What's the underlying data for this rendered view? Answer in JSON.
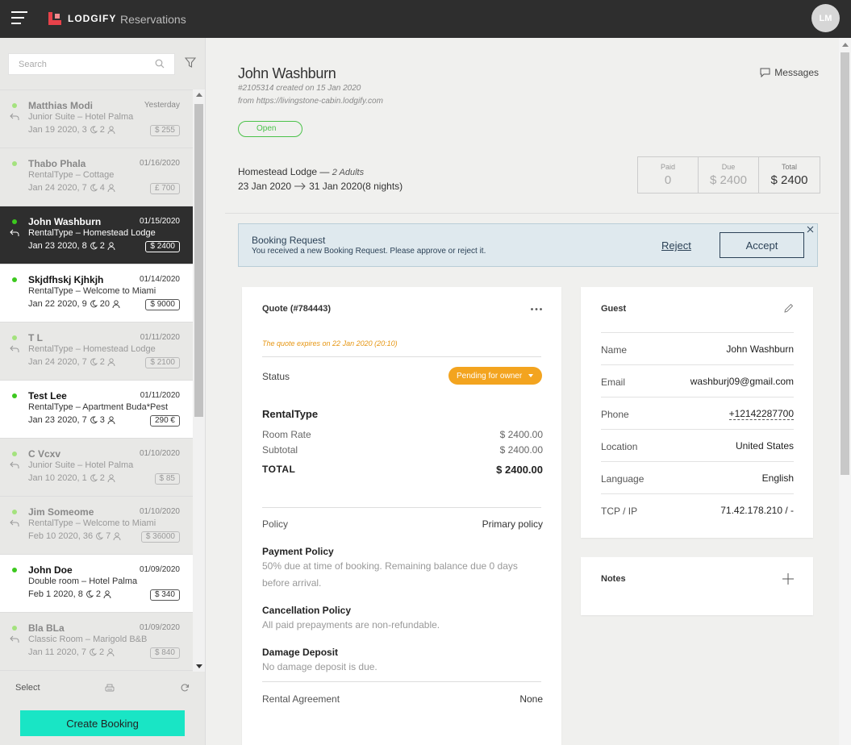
{
  "app": {
    "brand": "LODGIFY",
    "section": "Reservations",
    "user_initials": "LM"
  },
  "sidebar": {
    "search_placeholder": "Search",
    "reservations": [
      {
        "name": "Matthias Modi",
        "date": "Yesterday",
        "rental": "Junior Suite – Hotel Palma",
        "checkin": "Jan 19 2020, 3",
        "guests": "2",
        "price": "$ 255",
        "state": "read",
        "replied": true
      },
      {
        "name": "Thabo Phala",
        "date": "01/16/2020",
        "rental": "RentalType – Cottage",
        "checkin": "Jan 24 2020, 7",
        "guests": "4",
        "price": "£ 700",
        "state": "read",
        "replied": false
      },
      {
        "name": "John Washburn",
        "date": "01/15/2020",
        "rental": "RentalType – Homestead Lodge",
        "checkin": "Jan 23 2020, 8",
        "guests": "2",
        "price": "$ 2400",
        "state": "active",
        "replied": true
      },
      {
        "name": "Skjdfhskj Kjhkjh",
        "date": "01/14/2020",
        "rental": "RentalType – Welcome to Miami",
        "checkin": "Jan 22 2020, 9",
        "guests": "20",
        "price": "$ 9000",
        "state": "unread",
        "replied": false
      },
      {
        "name": "T L",
        "date": "01/11/2020",
        "rental": "RentalType – Homestead Lodge",
        "checkin": "Jan 24 2020, 7",
        "guests": "2",
        "price": "$ 2100",
        "state": "read",
        "replied": true
      },
      {
        "name": "Test Lee",
        "date": "01/11/2020",
        "rental": "RentalType – Apartment Buda*Pest",
        "checkin": "Jan 23 2020, 7",
        "guests": "3",
        "price": "290 €",
        "state": "unread",
        "replied": false
      },
      {
        "name": "C Vcxv",
        "date": "01/10/2020",
        "rental": "Junior Suite – Hotel Palma",
        "checkin": "Jan 10 2020, 1",
        "guests": "2",
        "price": "$ 85",
        "state": "read",
        "replied": true
      },
      {
        "name": "Jim Someome",
        "date": "01/10/2020",
        "rental": "RentalType – Welcome to Miami",
        "checkin": "Feb 10 2020, 36",
        "guests": "7",
        "price": "$ 36000",
        "state": "read",
        "replied": true
      },
      {
        "name": "John Doe",
        "date": "01/09/2020",
        "rental": "Double room – Hotel Palma",
        "checkin": "Feb 1 2020, 8",
        "guests": "2",
        "price": "$ 340",
        "state": "unread",
        "replied": false
      },
      {
        "name": "Bla BLa",
        "date": "01/09/2020",
        "rental": "Classic Room – Marigold B&B",
        "checkin": "Jan 11 2020, 7",
        "guests": "2",
        "price": "$ 840",
        "state": "read",
        "replied": true
      }
    ],
    "select_label": "Select",
    "create_booking": "Create  Booking"
  },
  "booking": {
    "guest_name": "John Washburn",
    "created": "#2105314 created on 15 Jan 2020",
    "from": "from https://livingstone-cabin.lodgify.com",
    "status": "Open",
    "messages_label": "Messages",
    "property": "Homestead Lodge",
    "property_sep": " — ",
    "adults": "2 Adults",
    "arrival": "23 Jan 2020",
    "departure": "31 Jan 2020",
    "nights": "(8 nights)",
    "paid_label": "Paid",
    "paid": "0",
    "due_label": "Due",
    "due": "$ 2400",
    "total_label": "Total",
    "total": "$ 2400"
  },
  "banner": {
    "title": "Booking Request",
    "text": "You received a new Booking Request. Please approve or reject it.",
    "reject": "Reject",
    "accept": "Accept"
  },
  "quote": {
    "title": "Quote (#784443)",
    "expires": "The quote expires on 22 Jan 2020 (20:10)",
    "status_label": "Status",
    "status_value": "Pending for owner",
    "rental_type": "RentalType",
    "room_rate_label": "Room Rate",
    "room_rate": "$ 2400.00",
    "subtotal_label": "Subtotal",
    "subtotal": "$ 2400.00",
    "total_label": "TOTAL",
    "total": "$ 2400.00",
    "policy_label": "Policy",
    "policy": "Primary policy",
    "payment_title": "Payment Policy",
    "payment_text": "50% due at time of booking. Remaining balance due 0 days before arrival.",
    "cancel_title": "Cancellation Policy",
    "cancel_text": "All paid prepayments are non-refundable.",
    "damage_title": "Damage Deposit",
    "damage_text": "No damage deposit is due.",
    "agreement_label": "Rental Agreement",
    "agreement": "None"
  },
  "guest": {
    "title": "Guest",
    "rows": [
      {
        "k": "Name",
        "v": "John Washburn"
      },
      {
        "k": "Email",
        "v": "washburj09@gmail.com"
      },
      {
        "k": "Phone",
        "v": "+12142287700"
      },
      {
        "k": "Location",
        "v": "United States"
      },
      {
        "k": "Language",
        "v": "English"
      },
      {
        "k": "TCP / IP",
        "v": "71.42.178.210 / -"
      }
    ]
  },
  "notes": {
    "title": "Notes"
  },
  "colors": {
    "accent": "#19e5c5",
    "dark": "#2e2e2e",
    "open": "#4bc24a",
    "pending": "#f3a41f",
    "brand": "#e8424a"
  }
}
